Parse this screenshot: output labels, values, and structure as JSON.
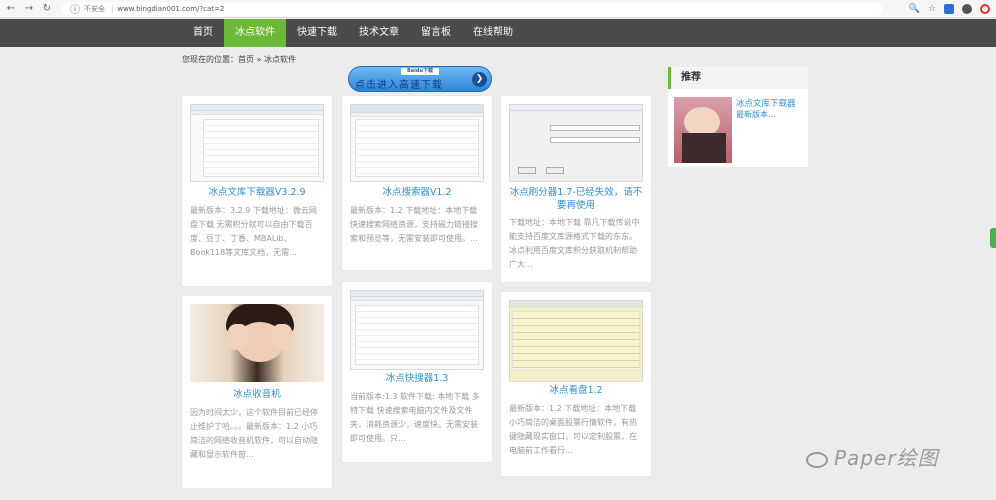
{
  "browser": {
    "insecure_label": "不安全",
    "url": "www.bingdian001.com/?cat=2"
  },
  "nav": [
    "首页",
    "冰点软件",
    "快速下载",
    "技术文章",
    "留言板",
    "在线帮助"
  ],
  "active_nav_index": 1,
  "breadcrumb": "您现在的位置：首页 » 冰点软件",
  "banner": {
    "logo": "Baidu下载",
    "text": "点击进入高速下载"
  },
  "cards": [
    {
      "title": "冰点文库下载器V3.2.9",
      "desc": "最新版本：3.2.9 下载地址：微云网盘下载 无需积分就可以自由下载百度、豆丁、丁香、MBALib、Book118等文库文档，无需..."
    },
    {
      "title": "冰点搜索器V1.2",
      "desc": "最新版本：1.2 下载地址：本地下载 快速搜索网络资源，支持磁力链接搜索和预览等，无需安装即可使用。..."
    },
    {
      "title": "冰点刷分器1.7-已经失效，请不要再使用",
      "desc": "下载地址：本地下载 靠凡下载传说中能支持百度文库源格式下载的东东。 冰点利用百度文库积分获取机制帮助广大..."
    },
    {
      "title": "冰点收音机",
      "desc": "因为时间太少，这个软件目前已经停止维护了哈。。。最新版本：1.2 小巧简洁的网络收音机软件，可以自动隐藏和显示软件窗..."
    },
    {
      "title": "冰点快搜器1.3",
      "desc": "当前版本:1.3 软件下载: 本地下载 多特下载 快速搜索电脑内文件及文件夹，消耗资源少，速度快。无需安装即可使用。只..."
    },
    {
      "title": "冰点看盘1.2",
      "desc": "最新版本：1.2 下载地址：本地下载 小巧简洁的桌面股票行情软件，有热键隐藏现实窗口，可以定制股票，在电脑前工作看行..."
    }
  ],
  "sidebar": {
    "heading": "推荐",
    "item_title": "冰点文库下载器",
    "item_sub": "最新版本..."
  },
  "watermark": "Paper绘图",
  "colors": {
    "nav_bg": "#4b4b4b",
    "nav_active": "#6cb93a",
    "link": "#2f8fcf"
  }
}
